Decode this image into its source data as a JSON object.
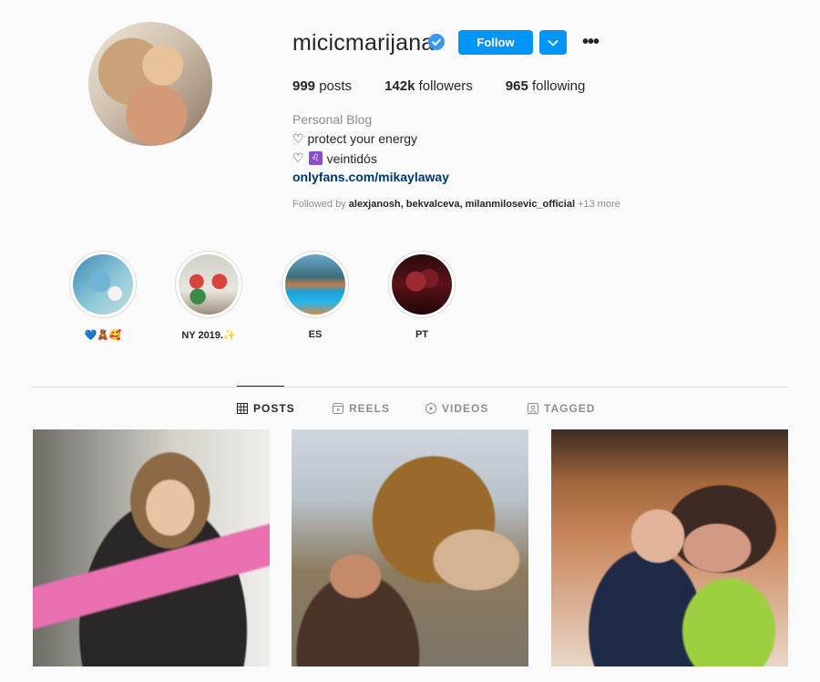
{
  "profile": {
    "username": "micicmarijana",
    "follow_label": "Follow",
    "more_label": "•••",
    "stats": {
      "posts_count": "999",
      "posts_label": "posts",
      "followers_count": "142k",
      "followers_label": "followers",
      "following_count": "965",
      "following_label": "following"
    },
    "category": "Personal Blog",
    "bio_line1": "♡ protect your energy",
    "bio_line2_prefix": "♡",
    "bio_line2_emoji": "♌",
    "bio_line2_text": "veintidós",
    "link": "onlyfans.com/mikaylaway",
    "followed_by_prefix": "Followed by",
    "followed_by_names": "alexjanosh, bekvalceva, milanmilosevic_official",
    "followed_by_more": "+13 more"
  },
  "highlights": [
    {
      "label": "💙🧸🥰"
    },
    {
      "label": "NY 2019.✨"
    },
    {
      "label": "ES"
    },
    {
      "label": "PT"
    }
  ],
  "tabs": [
    {
      "label": "POSTS",
      "icon": "grid-icon",
      "active": true
    },
    {
      "label": "REELS",
      "icon": "reels-icon",
      "active": false
    },
    {
      "label": "VIDEOS",
      "icon": "play-icon",
      "active": false
    },
    {
      "label": "TAGGED",
      "icon": "tag-icon",
      "active": false
    }
  ],
  "colors": {
    "accent": "#0095f6",
    "link": "#00376b",
    "muted": "#8e8e8e",
    "text": "#262626",
    "background": "#fafafa"
  }
}
